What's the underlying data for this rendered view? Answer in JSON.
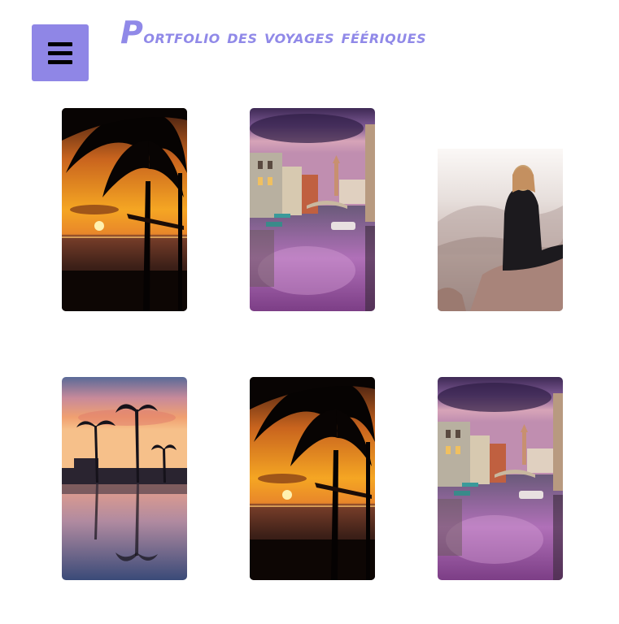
{
  "header": {
    "title_first_letter": "P",
    "title_rest": "ortfolio des voyages féériques",
    "menu_icon": "hamburger-menu-icon"
  },
  "gallery": {
    "photos": [
      {
        "name": "palm-sunset-beach",
        "alt": "palm-sunset-beach"
      },
      {
        "name": "purple-canal-city",
        "alt": "purple-canal-city"
      },
      {
        "name": "woman-on-rock-mist",
        "alt": "woman-on-rock-mist"
      },
      {
        "name": "palm-pool-reflection",
        "alt": "palm-pool-reflection"
      },
      {
        "name": "palm-sunset-beach",
        "alt": "palm-sunset-beach"
      },
      {
        "name": "purple-canal-city",
        "alt": "purple-canal-city"
      }
    ]
  },
  "colors": {
    "accent": "#8f86e6",
    "title": "#9089e8",
    "background": "#ffffff"
  }
}
